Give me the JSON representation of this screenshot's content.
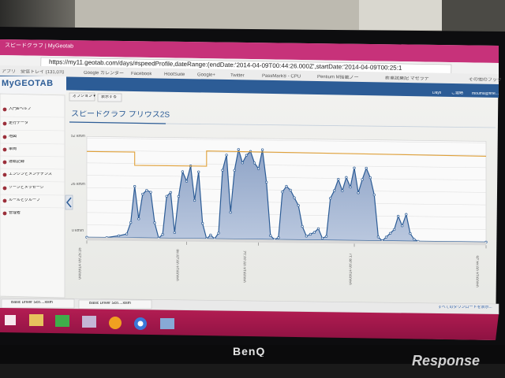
{
  "browser": {
    "tab_title": "スピードグラフ | MyGeotab",
    "url": "https://my11.geotab.com/days/#speedProfile,dateRange:(endDate:'2014-04-09T00:44:26.000Z',startDate:'2014-04-09T00:25:1",
    "bookmarks": [
      "アプリ",
      "受信トレイ (131,070",
      "Google カレンダー",
      "Facebook",
      "HootSuite",
      "Google+",
      "Twitter",
      "PassMark® - CPU",
      "Pentium M搭載ノー",
      "新車試乗記 マセラテ",
      "その他のブック"
    ]
  },
  "app": {
    "logo": "MyGEOTAB",
    "toolbar": [
      "オプション ▾",
      "表示する"
    ],
    "page_title": "スピードグラフ プリウス2S",
    "top_right": [
      "Days",
      "ご連絡",
      "mouma@fine..."
    ]
  },
  "sidebar": {
    "items": [
      "入門&ヘルプ",
      "走行データ",
      "地図",
      "車両",
      "運転記録",
      "エンジンとメンテナンス",
      "ゾーンとメッセージ",
      "ルールとグループ",
      "管理者"
    ]
  },
  "chart_data": {
    "type": "area",
    "ylabels": [
      "52 km/h",
      "26 km/h",
      "0 km/h"
    ],
    "ylim": [
      0,
      52
    ],
    "xticks": [
      "04/09/14 09:25:16",
      "04/09/14 09:29:48",
      "04/09/14 09:33:12",
      "04/09/14 09:38:17",
      "04/09/14 09:44:26"
    ],
    "speed_limit": [
      [
        0,
        45
      ],
      [
        12,
        45
      ],
      [
        12,
        38
      ],
      [
        30,
        38
      ],
      [
        30,
        46
      ],
      [
        100,
        45
      ]
    ],
    "speed": [
      [
        0,
        0
      ],
      [
        5,
        0
      ],
      [
        8,
        1
      ],
      [
        10,
        2
      ],
      [
        11,
        8
      ],
      [
        12,
        27
      ],
      [
        13,
        10
      ],
      [
        14,
        23
      ],
      [
        15,
        25
      ],
      [
        16,
        24
      ],
      [
        17,
        8
      ],
      [
        18,
        0
      ],
      [
        19,
        2
      ],
      [
        20,
        22
      ],
      [
        21,
        24
      ],
      [
        22,
        3
      ],
      [
        23,
        22
      ],
      [
        24,
        35
      ],
      [
        25,
        30
      ],
      [
        26,
        38
      ],
      [
        27,
        20
      ],
      [
        28,
        35
      ],
      [
        29,
        8
      ],
      [
        30,
        0
      ],
      [
        31,
        2
      ],
      [
        32,
        0
      ],
      [
        33,
        3
      ],
      [
        34,
        36
      ],
      [
        35,
        44
      ],
      [
        36,
        14
      ],
      [
        37,
        36
      ],
      [
        38,
        47
      ],
      [
        39,
        40
      ],
      [
        40,
        44
      ],
      [
        41,
        46
      ],
      [
        42,
        40
      ],
      [
        43,
        37
      ],
      [
        44,
        47
      ],
      [
        45,
        30
      ],
      [
        46,
        2
      ],
      [
        47,
        0
      ],
      [
        48,
        1
      ],
      [
        49,
        25
      ],
      [
        50,
        28
      ],
      [
        51,
        26
      ],
      [
        52,
        22
      ],
      [
        53,
        18
      ],
      [
        54,
        7
      ],
      [
        55,
        2
      ],
      [
        56,
        3
      ],
      [
        57,
        4
      ],
      [
        58,
        6
      ],
      [
        59,
        1
      ],
      [
        60,
        2
      ],
      [
        61,
        22
      ],
      [
        62,
        26
      ],
      [
        63,
        32
      ],
      [
        64,
        26
      ],
      [
        65,
        33
      ],
      [
        66,
        28
      ],
      [
        67,
        38
      ],
      [
        68,
        25
      ],
      [
        69,
        32
      ],
      [
        70,
        38
      ],
      [
        71,
        33
      ],
      [
        72,
        24
      ],
      [
        73,
        2
      ],
      [
        74,
        0
      ],
      [
        75,
        2
      ],
      [
        76,
        4
      ],
      [
        77,
        6
      ],
      [
        78,
        13
      ],
      [
        79,
        8
      ],
      [
        80,
        14
      ],
      [
        81,
        4
      ],
      [
        82,
        1
      ],
      [
        83,
        0
      ],
      [
        100,
        0
      ]
    ]
  },
  "taskbar": {
    "downloads": [
      "Basic Driver Sco....xlsm",
      "Basic Driver Sco....xlsm"
    ],
    "downloads_all": "すべてのダウンロードを表示..."
  },
  "monitor": {
    "brand": "BenQ",
    "watermark": "Response"
  }
}
